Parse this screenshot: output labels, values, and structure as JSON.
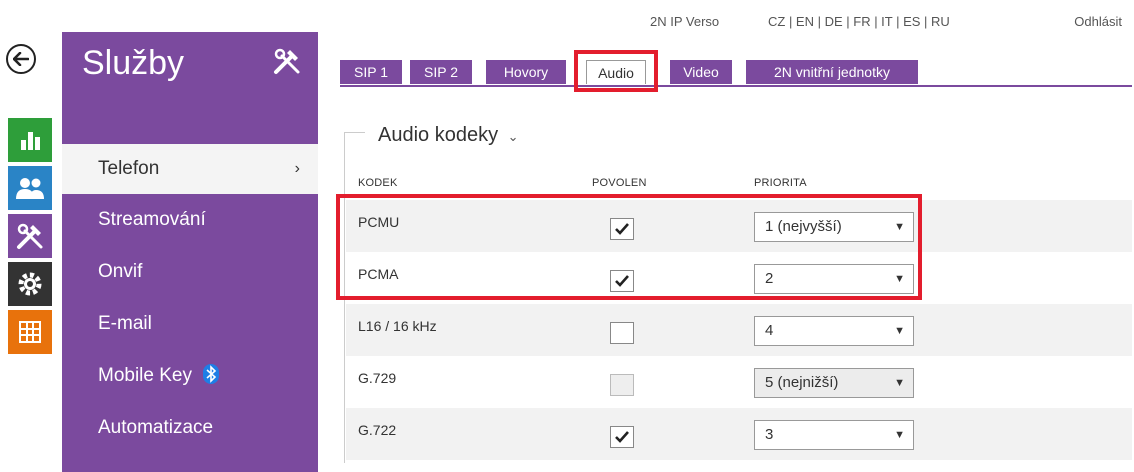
{
  "topbar": {
    "device_name": "2N IP Verso",
    "languages": "CZ | EN | DE | FR | IT | ES | RU",
    "logout": "Odhlásit"
  },
  "sidebar": {
    "title": "Služby",
    "items": [
      {
        "label": "Telefon",
        "active": true
      },
      {
        "label": "Streamování"
      },
      {
        "label": "Onvif"
      },
      {
        "label": "E-mail"
      },
      {
        "label": "Mobile Key"
      },
      {
        "label": "Automatizace"
      }
    ]
  },
  "icons": {
    "back": "back-arrow-icon",
    "status": "bar-chart-icon",
    "directory": "users-icon",
    "services": "tools-icon",
    "hardware": "gear-icon",
    "system": "grid-icon",
    "bluetooth": "bluetooth-icon"
  },
  "colors": {
    "purple": "#7b4a9e",
    "green": "#2e9e3a",
    "blue": "#2a84c6",
    "dark": "#333333",
    "orange": "#e8720c",
    "highlight_red": "#e31d2d"
  },
  "tabs": [
    {
      "label": "SIP 1"
    },
    {
      "label": "SIP 2"
    },
    {
      "label": "Hovory"
    },
    {
      "label": "Audio",
      "active": true
    },
    {
      "label": "Video"
    },
    {
      "label": "2N vnitřní jednotky"
    }
  ],
  "section": {
    "title": "Audio kodeky",
    "columns": {
      "codec": "KODEK",
      "enabled": "POVOLEN",
      "priority": "PRIORITA"
    }
  },
  "codecs": [
    {
      "name": "PCMU",
      "enabled": true,
      "priority": "1 (nejvyšší)",
      "disabled": false
    },
    {
      "name": "PCMA",
      "enabled": true,
      "priority": "2",
      "disabled": false
    },
    {
      "name": "L16 / 16 kHz",
      "enabled": false,
      "priority": "4",
      "disabled": false
    },
    {
      "name": "G.729",
      "enabled": false,
      "priority": "5 (nejnižší)",
      "disabled": true
    },
    {
      "name": "G.722",
      "enabled": true,
      "priority": "3",
      "disabled": false
    }
  ]
}
